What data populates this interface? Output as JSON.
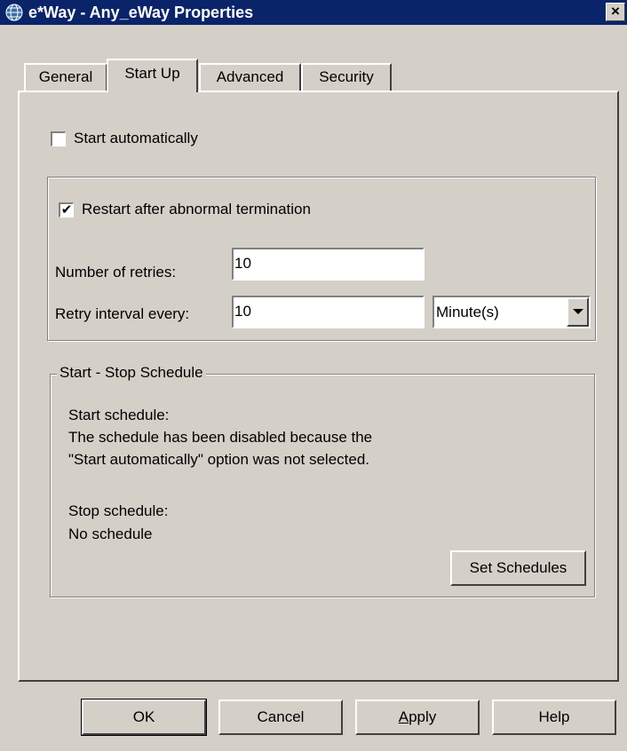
{
  "window": {
    "title": "e*Way - Any_eWay Properties",
    "close_label": "×"
  },
  "tabs": [
    {
      "label": "General",
      "active": false
    },
    {
      "label": "Start Up",
      "active": true
    },
    {
      "label": "Advanced",
      "active": false
    },
    {
      "label": "Security",
      "active": false
    }
  ],
  "startup": {
    "start_automatically": {
      "label": "Start automatically",
      "checked": false
    },
    "restart": {
      "label": "Restart after abnormal termination",
      "checked": true,
      "check_glyph": "✔"
    },
    "retries": {
      "label": "Number of retries:",
      "value": "10"
    },
    "interval": {
      "label": "Retry interval every:",
      "value": "10",
      "unit": "Minute(s)"
    }
  },
  "schedule": {
    "legend": "Start - Stop Schedule",
    "start_heading": "Start schedule:",
    "start_line1": "The schedule has been disabled because the",
    "start_line2": "\"Start automatically\" option was not selected.",
    "stop_heading": "Stop schedule:",
    "stop_value": "No schedule",
    "set_button": "Set Schedules"
  },
  "buttons": {
    "ok": "OK",
    "cancel": "Cancel",
    "apply_first": "A",
    "apply_rest": "pply",
    "help": "Help"
  },
  "colors": {
    "titlebar": "#0a246a",
    "face": "#d4d0c8"
  }
}
